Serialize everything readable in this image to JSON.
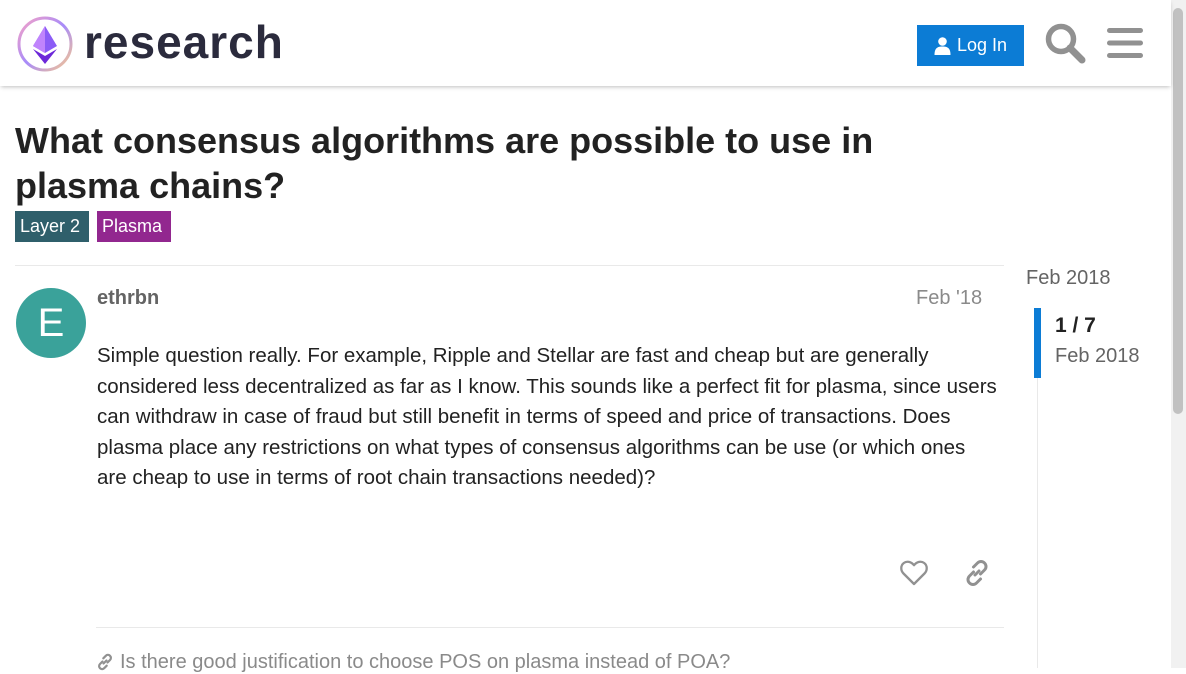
{
  "header": {
    "logo_text": "research",
    "login_label": "Log In",
    "icons": [
      "ethereum-logo-icon",
      "user-icon",
      "search-icon",
      "hamburger-menu-icon"
    ]
  },
  "topic": {
    "title": "What consensus algorithms are possible to use in plasma chains?",
    "tags": [
      {
        "label": "Layer 2",
        "color": "#2f5f6b"
      },
      {
        "label": "Plasma",
        "color": "#92278f"
      }
    ]
  },
  "post": {
    "avatar_letter": "E",
    "avatar_color": "#3aa29a",
    "username": "ethrbn",
    "date": "Feb '18",
    "body": "Simple question really. For example, Ripple and Stellar are fast and cheap but are generally considered less decentralized as far as I know. This sounds like a perfect fit for plasma, since users can withdraw in case of fraud but still benefit in terms of speed and price of transactions. Does plasma place any restrictions on what types of consensus algorithms can be use (or which ones are cheap to use in terms of root chain transactions needed)?",
    "actions": [
      "heart-icon",
      "link-icon"
    ],
    "linked_topic": "Is there good justification to choose POS on plasma instead of POA?"
  },
  "timeline": {
    "start_date": "Feb 2018",
    "position": "1 / 7",
    "position_value": 1,
    "total_posts": 7,
    "current_date": "Feb 2018"
  },
  "colors": {
    "accent": "#0c7cd5",
    "text": "#222222",
    "muted": "#646464"
  }
}
